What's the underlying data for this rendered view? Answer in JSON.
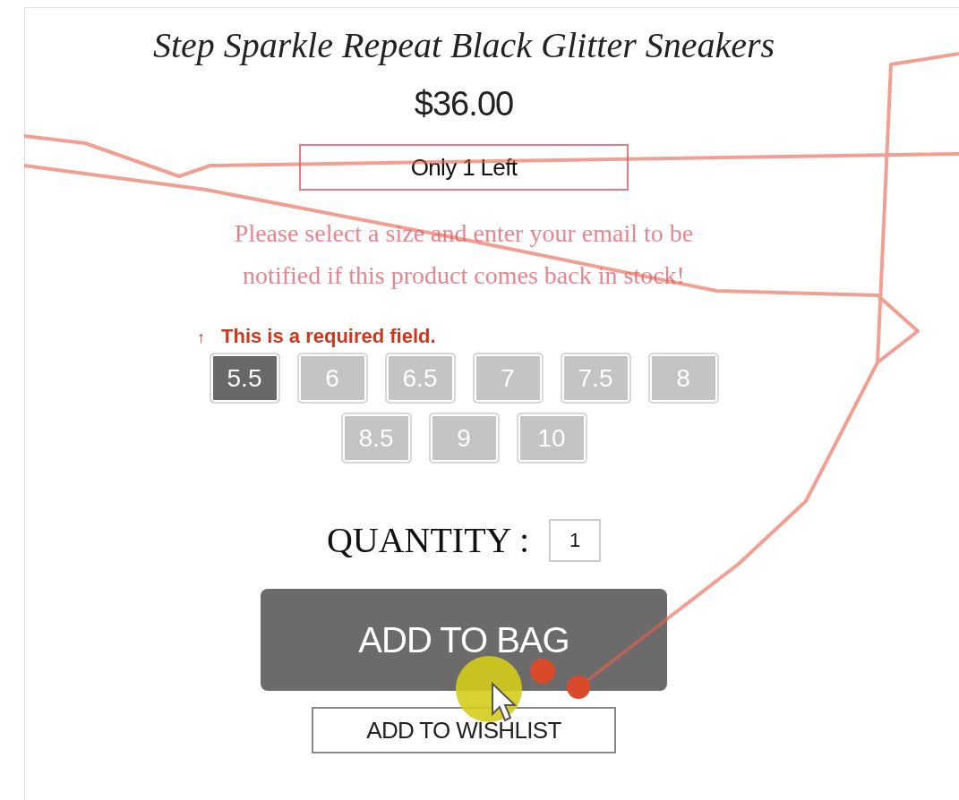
{
  "product": {
    "title": "Step Sparkle Repeat Black Glitter Sneakers",
    "price": "$36.00",
    "stock_badge": "Only 1 Left",
    "notify_message": "Please select a size and enter your email to be notified if this product comes back in stock!"
  },
  "size_picker": {
    "error_icon": "↑",
    "error": "This is a required field.",
    "sizes": [
      {
        "label": "5.5",
        "selected": true
      },
      {
        "label": "6",
        "selected": false
      },
      {
        "label": "6.5",
        "selected": false
      },
      {
        "label": "7",
        "selected": false
      },
      {
        "label": "7.5",
        "selected": false
      },
      {
        "label": "8",
        "selected": false
      },
      {
        "label": "8.5",
        "selected": false
      },
      {
        "label": "9",
        "selected": false
      },
      {
        "label": "10",
        "selected": false
      }
    ]
  },
  "quantity": {
    "label": "QUANTITY :",
    "value": "1"
  },
  "buttons": [
    {
      "kind": "primary",
      "label": "ADD TO BAG"
    },
    {
      "kind": "secondary",
      "label": "ADD TO WISHLIST"
    }
  ]
}
